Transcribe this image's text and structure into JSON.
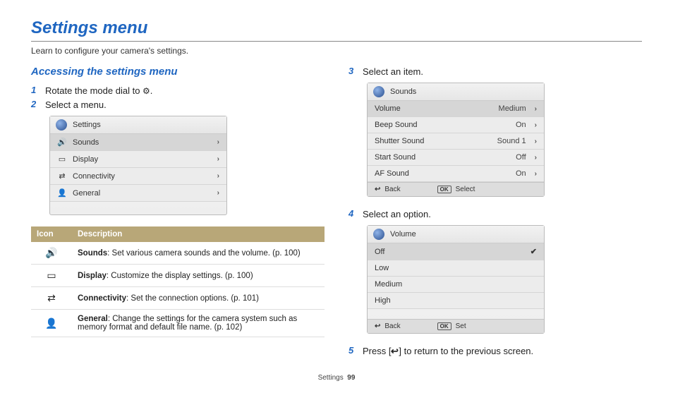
{
  "title": "Settings menu",
  "subtitle": "Learn to configure your camera's settings.",
  "section_heading": "Accessing the settings menu",
  "steps": {
    "s1": {
      "num": "1",
      "text_before": "Rotate the mode dial to ",
      "text_after": "."
    },
    "s2": {
      "num": "2",
      "text": "Select a menu."
    },
    "s3": {
      "num": "3",
      "text": "Select an item."
    },
    "s4": {
      "num": "4",
      "text": "Select an option."
    },
    "s5": {
      "num": "5",
      "text_before": "Press [",
      "text_after": "] to return to the previous screen."
    }
  },
  "cam1": {
    "title": "Settings",
    "rows": [
      {
        "icon": "sound",
        "label": "Sounds",
        "sel": true
      },
      {
        "icon": "display",
        "label": "Display"
      },
      {
        "icon": "conn",
        "label": "Connectivity"
      },
      {
        "icon": "general",
        "label": "General"
      }
    ]
  },
  "cam2": {
    "title": "Sounds",
    "rows": [
      {
        "label": "Volume",
        "value": "Medium",
        "sel": true
      },
      {
        "label": "Beep Sound",
        "value": "On"
      },
      {
        "label": "Shutter Sound",
        "value": "Sound 1"
      },
      {
        "label": "Start Sound",
        "value": "Off"
      },
      {
        "label": "AF Sound",
        "value": "On"
      }
    ],
    "footer": {
      "back": "Back",
      "action": "Select"
    }
  },
  "cam3": {
    "title": "Volume",
    "rows": [
      {
        "label": "Off",
        "sel": true,
        "check": true
      },
      {
        "label": "Low"
      },
      {
        "label": "Medium"
      },
      {
        "label": "High"
      }
    ],
    "footer": {
      "back": "Back",
      "action": "Set"
    }
  },
  "table": {
    "head_icon": "Icon",
    "head_desc": "Description",
    "rows": [
      {
        "icon": "sound",
        "bold": "Sounds",
        "desc": ": Set various camera sounds and the volume. (p. 100)"
      },
      {
        "icon": "display",
        "bold": "Display",
        "desc": ": Customize the display settings. (p. 100)"
      },
      {
        "icon": "conn",
        "bold": "Connectivity",
        "desc": ": Set the connection options. (p. 101)"
      },
      {
        "icon": "general",
        "bold": "General",
        "desc": ": Change the settings for the camera system such as memory format and default file name. (p. 102)"
      }
    ]
  },
  "icons": {
    "sound": "🔊",
    "display": "▭",
    "conn": "⇄",
    "general": "👤",
    "gear": "⚙",
    "back": "↩",
    "ok": "OK",
    "check": "✔"
  },
  "footer": {
    "section": "Settings",
    "page": "99"
  }
}
